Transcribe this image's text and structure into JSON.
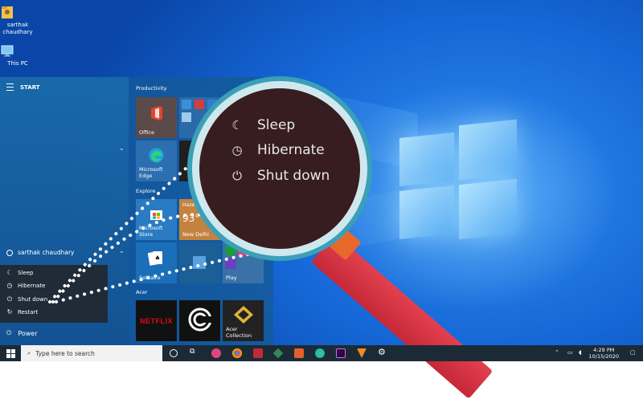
{
  "desktop": {
    "icons": [
      {
        "label": "sarthak chaudhary",
        "icon": "folder-icon"
      },
      {
        "label": "This PC",
        "icon": "computer-icon"
      }
    ]
  },
  "start_menu": {
    "header": "START",
    "user_name": "sarthak chaudhary",
    "power_label": "Power",
    "power_menu": [
      {
        "label": "Sleep",
        "icon": "moon-icon"
      },
      {
        "label": "Hibernate",
        "icon": "clock-icon"
      },
      {
        "label": "Shut down",
        "icon": "power-icon"
      },
      {
        "label": "Restart",
        "icon": "restart-icon"
      }
    ],
    "groups": {
      "productivity": "Productivity",
      "explore": "Explore",
      "acer": "Acer"
    },
    "tiles": {
      "office": "Office",
      "edge": "Microsoft Edge",
      "weather_condition": "Haze",
      "weather_temp": "93°",
      "weather_city": "New Delhi",
      "store": "Microsoft Store",
      "solitaire": "Solitaire",
      "play": "Play",
      "netflix": "NETFLIX",
      "acer_collection": "Acer Collection"
    }
  },
  "magnifier": {
    "items": [
      {
        "label": "Sleep",
        "icon": "moon-icon"
      },
      {
        "label": "Hibernate",
        "icon": "clock-icon"
      },
      {
        "label": "Shut down",
        "icon": "power-icon"
      }
    ]
  },
  "taskbar": {
    "search_placeholder": "Type here to search",
    "time": "4:29 PM",
    "date": "10/15/2020"
  },
  "colors": {
    "accent": "#1566d6",
    "lens_bg": "#381d20",
    "magnifier_handle": "#c62838",
    "netflix": "#e50914"
  }
}
